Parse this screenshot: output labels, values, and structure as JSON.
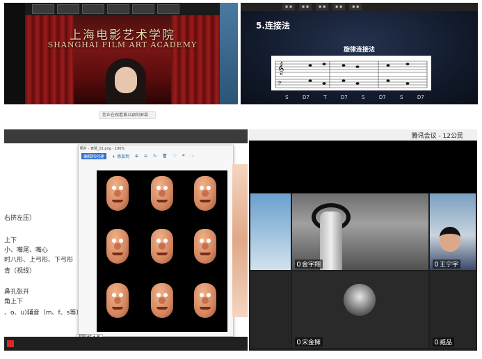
{
  "panel_top_left": {
    "title_cn": "上海电影艺术学院",
    "title_en": "SHANGHAI FILM ART ACADEMY"
  },
  "caption_pill": "您正在观看黄以颖的屏幕",
  "panel_top_right": {
    "heading": "5.连接法",
    "subheading": "旋律连接法",
    "degrees": [
      "S",
      "D7",
      "T",
      "D7",
      "S",
      "D7",
      "S",
      "D7"
    ]
  },
  "panel_bottom_left": {
    "doc_lines": [
      "右挤左压）",
      "上下",
      "小、嘴尾、嘴心",
      "时八形、上弓形、下弓形",
      "青（视线）",
      "鼻孔张开",
      "角上下",
      "、o、u)辅音（m、f、s等）"
    ],
    "viewer_title": "照片 - 表情_01.png - 100%",
    "viewer_edit_label": "编辑和创建",
    "viewer_add_label": "+ 添加到",
    "screenshot_tip": "截图(Alt + A)"
  },
  "panel_bottom_right": {
    "header_title": "腾讯会议 - 12公民",
    "participants": [
      "金宇翔",
      "王宁宇",
      "宋金擁",
      "臧品"
    ]
  }
}
